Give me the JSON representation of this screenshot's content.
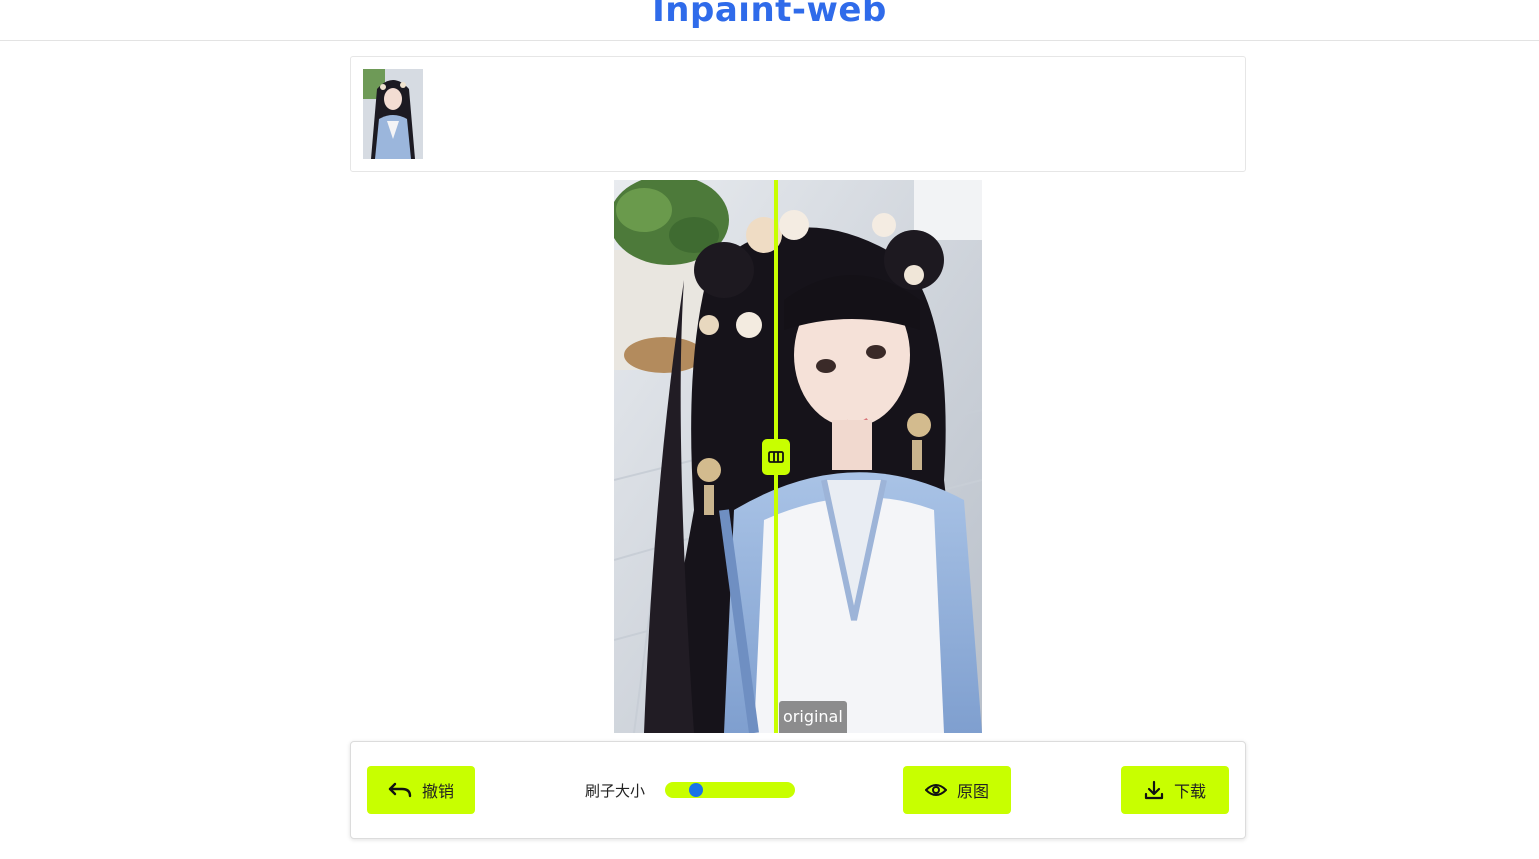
{
  "header": {
    "title": "Inpaint-web"
  },
  "gallery": {
    "thumbnails": [
      {
        "selected": true
      }
    ]
  },
  "viewer": {
    "compare_position": 0.44,
    "original_label": "original",
    "accent_color": "#c8ff00"
  },
  "toolbar": {
    "undo_label": "撤销",
    "undo_icon": "undo-arrow-icon",
    "brush_label": "刷子大小",
    "brush_size": 0.2,
    "original_label": "原图",
    "original_icon": "eye-icon",
    "download_label": "下载",
    "download_icon": "download-icon"
  },
  "colors": {
    "title": "#2f6bea",
    "accent": "#c8ff00",
    "slider_thumb": "#1a73e8"
  }
}
